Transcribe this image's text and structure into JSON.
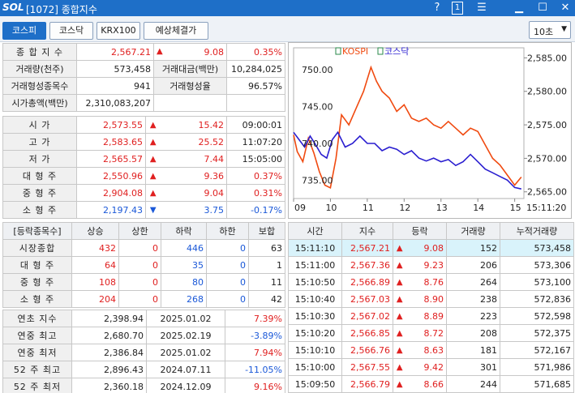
{
  "window": {
    "logo": "SOL",
    "title": "[1072] 종합지수",
    "help": "?",
    "page_no": "1"
  },
  "tabs": [
    {
      "label": "코스피",
      "active": true
    },
    {
      "label": "코스닥",
      "active": false
    },
    {
      "label": "KRX100",
      "active": false
    },
    {
      "label": "예상체결가",
      "active": false
    }
  ],
  "interval": "10초",
  "summary": {
    "index_label": "종 합 지 수",
    "index_value": "2,567.21",
    "index_change": "9.08",
    "index_rate": "0.35%",
    "volume_label": "거래량(천주)",
    "volume": "573,458",
    "amount_label": "거래대금(백만)",
    "amount": "10,284,025",
    "formed_count_label": "거래형성종목수",
    "formed_count": "941",
    "formed_rate_label": "거래형성율",
    "formed_rate": "96.57%",
    "market_cap_label": "시가총액(백만)",
    "market_cap": "2,310,083,207"
  },
  "prices": [
    {
      "label": "시 가",
      "value": "2,573.55",
      "dir": "up",
      "change": "15.42",
      "extra": "09:00:01"
    },
    {
      "label": "고 가",
      "value": "2,583.65",
      "dir": "up",
      "change": "25.52",
      "extra": "11:07:20"
    },
    {
      "label": "저 가",
      "value": "2,565.57",
      "dir": "up",
      "change": "7.44",
      "extra": "15:05:00"
    },
    {
      "label": "대 형 주",
      "value": "2,550.96",
      "dir": "up",
      "change": "9.36",
      "extra": "0.37%"
    },
    {
      "label": "중 형 주",
      "value": "2,904.08",
      "dir": "up",
      "change": "9.04",
      "extra": "0.31%"
    },
    {
      "label": "소 형 주",
      "value": "2,197.43",
      "dir": "down",
      "change": "3.75",
      "extra": "-0.17%"
    }
  ],
  "breadth": {
    "headers": [
      "[등락종목수]",
      "상승",
      "상한",
      "하락",
      "하한",
      "보합"
    ],
    "rows": [
      {
        "label": "시장종합",
        "up": "432",
        "upper": "0",
        "down": "446",
        "lower": "0",
        "flat": "63"
      },
      {
        "label": "대 형 주",
        "up": "64",
        "upper": "0",
        "down": "35",
        "lower": "0",
        "flat": "1"
      },
      {
        "label": "중 형 주",
        "up": "108",
        "upper": "0",
        "down": "80",
        "lower": "0",
        "flat": "11"
      },
      {
        "label": "소 형 주",
        "up": "204",
        "upper": "0",
        "down": "268",
        "lower": "0",
        "flat": "42"
      }
    ]
  },
  "yearly": [
    {
      "label": "연초 지수",
      "value": "2,398.94",
      "date": "2025.01.02",
      "rate": "7.39%",
      "dir": "up"
    },
    {
      "label": "연중 최고",
      "value": "2,680.70",
      "date": "2025.02.19",
      "rate": "-3.89%",
      "dir": "down"
    },
    {
      "label": "연중 최저",
      "value": "2,386.84",
      "date": "2025.01.02",
      "rate": "7.94%",
      "dir": "up"
    },
    {
      "label": "52 주 최고",
      "value": "2,896.43",
      "date": "2024.07.11",
      "rate": "-11.05%",
      "dir": "down"
    },
    {
      "label": "52 주 최저",
      "value": "2,360.18",
      "date": "2024.12.09",
      "rate": "9.16%",
      "dir": "up"
    }
  ],
  "ticks": {
    "headers": [
      "시간",
      "지수",
      "등락",
      "거래량",
      "누적거래량"
    ],
    "rows": [
      {
        "time": "15:11:10",
        "index": "2,567.21",
        "change": "9.08",
        "volume": "152",
        "cum": "573,458"
      },
      {
        "time": "15:11:00",
        "index": "2,567.36",
        "change": "9.23",
        "volume": "206",
        "cum": "573,306"
      },
      {
        "time": "15:10:50",
        "index": "2,566.89",
        "change": "8.76",
        "volume": "264",
        "cum": "573,100"
      },
      {
        "time": "15:10:40",
        "index": "2,567.03",
        "change": "8.90",
        "volume": "238",
        "cum": "572,836"
      },
      {
        "time": "15:10:30",
        "index": "2,567.02",
        "change": "8.89",
        "volume": "223",
        "cum": "572,598"
      },
      {
        "time": "15:10:20",
        "index": "2,566.85",
        "change": "8.72",
        "volume": "208",
        "cum": "572,375"
      },
      {
        "time": "15:10:10",
        "index": "2,566.76",
        "change": "8.63",
        "volume": "181",
        "cum": "572,167"
      },
      {
        "time": "15:10:00",
        "index": "2,567.55",
        "change": "9.42",
        "volume": "301",
        "cum": "571,986"
      },
      {
        "time": "15:09:50",
        "index": "2,566.79",
        "change": "8.66",
        "volume": "244",
        "cum": "571,685"
      }
    ]
  },
  "chart_data": {
    "type": "line",
    "legend": [
      "KOSPI",
      "코스닥"
    ],
    "x_ticks": [
      "09",
      "10",
      "11",
      "12",
      "13",
      "14",
      "15",
      "15:11:20"
    ],
    "y_left_ticks": [
      "750.00",
      "745.00",
      "740.00",
      "735.00"
    ],
    "y_right_ticks": [
      "2,585.00",
      "2,580.00",
      "2,575.00",
      "2,570.00",
      "2,565.00"
    ],
    "ylim_left": [
      732.5,
      753.0
    ],
    "ylim_right": [
      2564.0,
      2586.5
    ],
    "series": [
      {
        "name": "KOSPI",
        "color": "#f04a10",
        "axis": "right",
        "x": [
          9.0,
          9.1,
          9.25,
          9.4,
          9.55,
          9.7,
          9.85,
          10.0,
          10.15,
          10.3,
          10.5,
          10.7,
          10.9,
          11.1,
          11.25,
          11.4,
          11.6,
          11.8,
          12.0,
          12.2,
          12.4,
          12.6,
          12.8,
          13.0,
          13.2,
          13.4,
          13.6,
          13.8,
          14.0,
          14.2,
          14.4,
          14.6,
          14.8,
          15.0,
          15.18
        ],
        "y": [
          2573.5,
          2571.0,
          2569.5,
          2573.0,
          2570.8,
          2568.0,
          2566.0,
          2565.6,
          2570.0,
          2576.5,
          2575.0,
          2577.5,
          2580.0,
          2583.6,
          2581.5,
          2580.0,
          2579.0,
          2577.0,
          2578.0,
          2576.0,
          2575.5,
          2576.0,
          2575.0,
          2574.5,
          2575.5,
          2574.5,
          2573.5,
          2574.5,
          2574.0,
          2572.0,
          2570.0,
          2569.0,
          2567.5,
          2566.0,
          2567.2
        ]
      },
      {
        "name": "코스닥",
        "color": "#2b1fd0",
        "axis": "left",
        "x": [
          9.0,
          9.15,
          9.3,
          9.45,
          9.6,
          9.75,
          9.9,
          10.05,
          10.2,
          10.4,
          10.6,
          10.8,
          11.0,
          11.2,
          11.4,
          11.6,
          11.8,
          12.0,
          12.2,
          12.4,
          12.6,
          12.8,
          13.0,
          13.2,
          13.4,
          13.6,
          13.8,
          14.0,
          14.2,
          14.4,
          14.6,
          14.8,
          15.0,
          15.18
        ],
        "y": [
          741.5,
          740.5,
          739.5,
          741.0,
          739.8,
          738.5,
          738.0,
          740.5,
          741.5,
          739.5,
          740.0,
          741.0,
          740.0,
          740.0,
          739.0,
          739.5,
          739.2,
          738.5,
          739.0,
          738.0,
          737.6,
          738.0,
          737.5,
          737.8,
          737.0,
          737.5,
          738.5,
          737.5,
          736.5,
          736.0,
          735.5,
          735.0,
          734.0,
          733.8
        ]
      }
    ]
  }
}
